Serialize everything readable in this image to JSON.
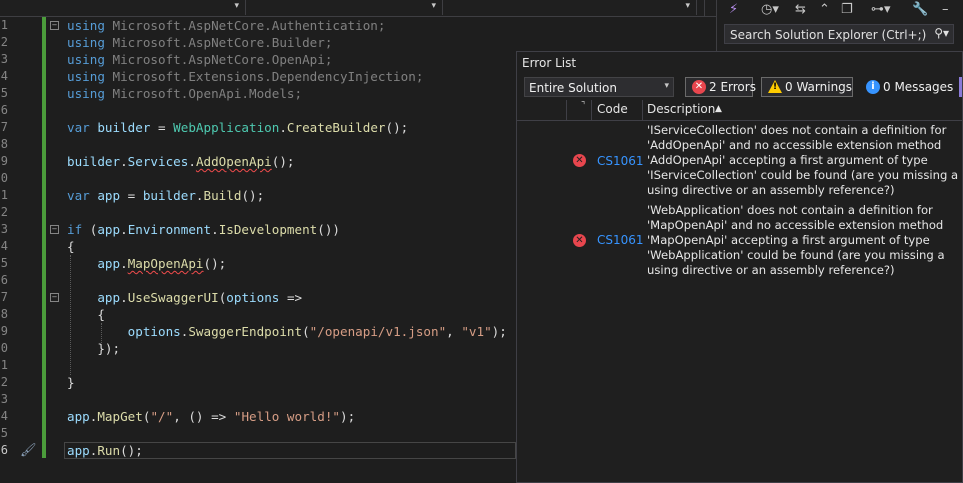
{
  "editor": {
    "line_numbers": [
      "1",
      "2",
      "3",
      "4",
      "5",
      "6",
      "7",
      "8",
      "9",
      "0",
      "1",
      "2",
      "3",
      "4",
      "5",
      "6",
      "7",
      "8",
      "9",
      "0",
      "1",
      "2",
      "3",
      "4",
      "5",
      "6"
    ],
    "current_line_number": "6"
  },
  "solution_explorer": {
    "search_placeholder": "Search Solution Explorer (Ctrl+;)"
  },
  "error_list": {
    "title": "Error List",
    "scope": "Entire Solution",
    "errors_label": "2 Errors",
    "warnings_label": "0 Warnings",
    "messages_label": "0 Messages",
    "columns": {
      "code": "Code",
      "description": "Description"
    },
    "rows": [
      {
        "code": "CS1061",
        "description": "'IServiceCollection' does not contain a definition for 'AddOpenApi' and no accessible extension method 'AddOpenApi' accepting a first argument of type 'IServiceCollection' could be found (are you missing a using directive or an assembly reference?)"
      },
      {
        "code": "CS1061",
        "description": "'WebApplication' does not contain a definition for 'MapOpenApi' and no accessible extension method 'MapOpenApi' accepting a first argument of type 'WebApplication' could be found (are you missing a using directive or an assembly reference?)"
      }
    ]
  },
  "colors": {
    "keyword": "#569cd6",
    "variable": "#9cdcfe",
    "type": "#4ec9b0",
    "method": "#dcdcaa",
    "string": "#d69d85",
    "error": "#e8464e",
    "change_bar": "#4b9c3b"
  },
  "icons": [
    "sparkle-icon",
    "history-icon",
    "back-forward-icon",
    "collapse-icon",
    "copy-icon",
    "switch-views-icon",
    "wrench-icon",
    "search-icon",
    "error-icon",
    "warning-icon",
    "info-icon",
    "paintbrush-icon"
  ]
}
